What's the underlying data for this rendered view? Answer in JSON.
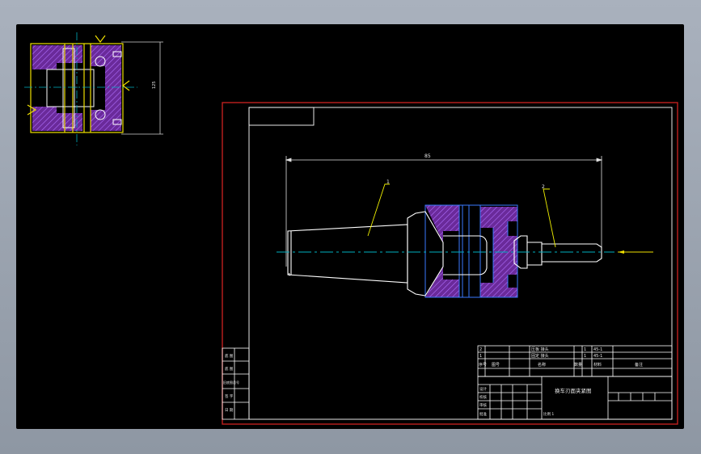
{
  "colors": {
    "background": "#000000",
    "frame_border": "#c0201e",
    "outline": "#ffffff",
    "centerline": "#00b0c0",
    "dimension": "#e0e0e0",
    "hatch": "#7050ff",
    "leader": "#f0f000",
    "section_yellow": "#f0e000",
    "part_fill": "#7a2bbd"
  },
  "dimensions": {
    "overall_length": "85"
  },
  "balloons": {
    "part1": "1",
    "part2": "2"
  },
  "title_block": {
    "drawing_name": "换车刃面夹紧图",
    "row_label_serial": "序号",
    "row_label_code": "图号",
    "row_label_name": "名称",
    "row_label_qty": "数量",
    "row_label_material": "材料",
    "row_label_remark": "备注",
    "parts": [
      {
        "no": "2",
        "name": "压板 接头",
        "qty": "1",
        "material": "45-1"
      },
      {
        "no": "1",
        "name": "固定 接头",
        "qty": "1",
        "material": "45-1"
      }
    ],
    "sign_rows": [
      {
        "label": "设计"
      },
      {
        "label": "校核"
      },
      {
        "label": "审核"
      },
      {
        "label": "批准"
      }
    ],
    "scale_note": "比例 1",
    "left_strip": [
      "底 图",
      "底 图",
      "旧底图总号",
      "签 字",
      "日 期"
    ]
  }
}
